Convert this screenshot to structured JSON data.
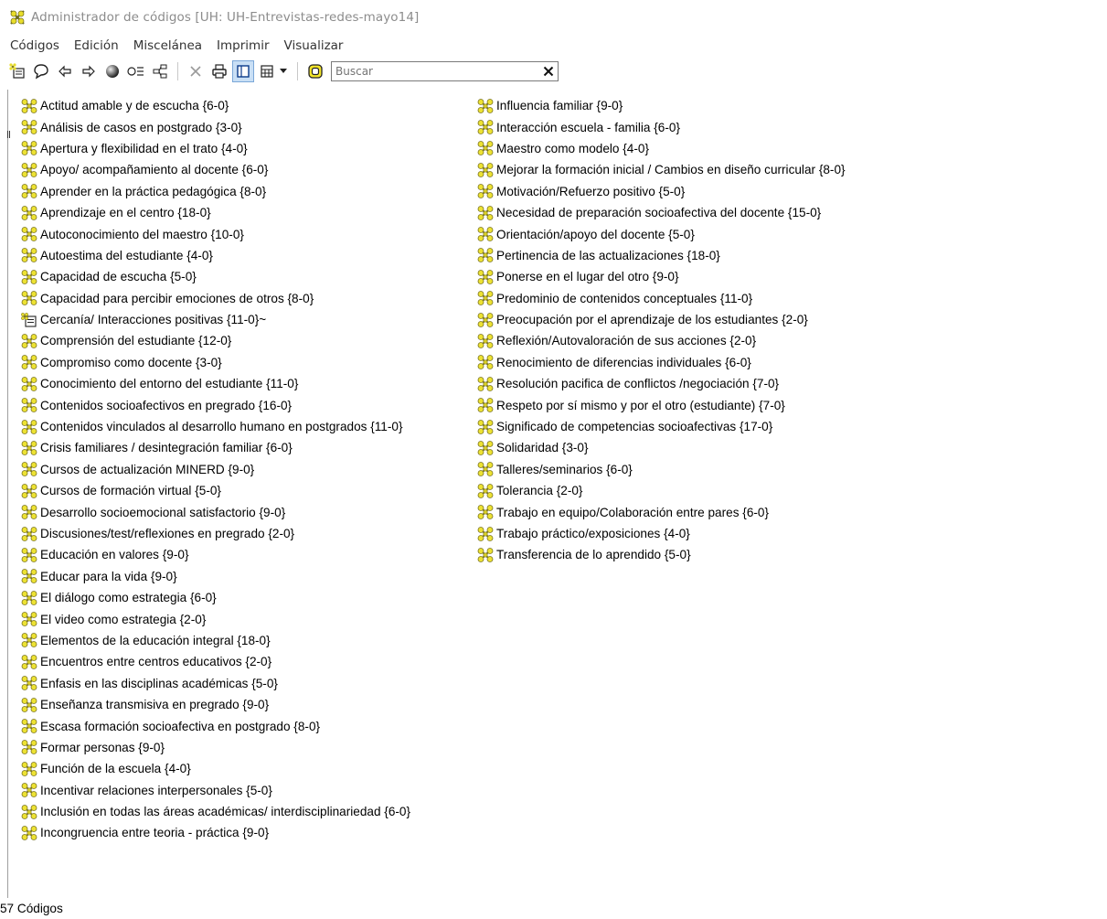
{
  "window": {
    "title": "Administrador de códigos [UH: UH-Entrevistas-redes-mayo14]"
  },
  "menu": [
    "Códigos",
    "Edición",
    "Miscelánea",
    "Imprimir",
    "Visualizar"
  ],
  "toolbar": {
    "icons": [
      "new-code-icon",
      "comment-icon",
      "back-arrow-icon",
      "forward-arrow-icon",
      "color-ball-icon",
      "code-filter-icon",
      "network-icon",
      "delete-icon",
      "print-icon",
      "single-column-view-icon",
      "multi-column-view-icon",
      "dropdown-arrow-icon",
      "search-target-icon"
    ],
    "search_placeholder": "Buscar"
  },
  "codes_column_1": [
    "Actitud amable y de escucha {6-0}",
    "Análisis de casos en postgrado {3-0}",
    "Apertura y flexibilidad en el trato {4-0}",
    "Apoyo/ acompañamiento al docente {6-0}",
    "Aprender en la práctica pedagógica {8-0}",
    "Aprendizaje en el centro {18-0}",
    "Autoconocimiento del maestro {10-0}",
    "Autoestima del estudiante {4-0}",
    "Capacidad de escucha {5-0}",
    "Capacidad para percibir emociones de otros {8-0}",
    "Cercanía/ Interacciones positivas {11-0}~",
    "Comprensión del estudiante {12-0}",
    "Compromiso como docente {3-0}",
    "Conocimiento del entorno del estudiante {11-0}",
    "Contenidos socioafectivos en pregrado {16-0}",
    "Contenidos vinculados al desarrollo humano en postgrados {11-0}",
    "Crisis familiares / desintegración familiar {6-0}",
    "Cursos de actualización MINERD {9-0}",
    "Cursos de formación virtual {5-0}",
    "Desarrollo socioemocional satisfactorio {9-0}",
    "Discusiones/test/reflexiones en pregrado {2-0}",
    "Educación en valores {9-0}",
    "Educar para la vida {9-0}",
    "El diálogo como estrategia {6-0}",
    "El video como estrategia {2-0}",
    "Elementos de  la educación integral {18-0}",
    "Encuentros entre centros educativos {2-0}",
    "Enfasis en las disciplinas académicas {5-0}",
    "Enseñanza transmisiva en pregrado {9-0}",
    "Escasa formación socioafectiva en postgrado {8-0}",
    "Formar personas {9-0}",
    "Función de la escuela {4-0}",
    "Incentivar relaciones interpersonales {5-0}",
    "Inclusión en todas las áreas académicas/ interdisciplinariedad {6-0}",
    "Incongruencia entre teoria - práctica {9-0}"
  ],
  "codes_column_2": [
    "Influencia familiar {9-0}",
    "Interacción escuela - familia {6-0}",
    "Maestro como modelo {4-0}",
    "Mejorar la formación inicial / Cambios en diseño curricular {8-0}",
    "Motivación/Refuerzo positivo {5-0}",
    "Necesidad de preparación socioafectiva del docente {15-0}",
    "Orientación/apoyo del docente {5-0}",
    "Pertinencia de las actualizaciones {18-0}",
    "Ponerse en el lugar del otro {9-0}",
    "Predominio de contenidos conceptuales {11-0}",
    "Preocupación por el aprendizaje de los estudiantes {2-0}",
    "Reflexión/Autovaloración de sus acciones {2-0}",
    "Renocimiento de diferencias individuales {6-0}",
    "Resolución pacifica de conflictos /negociación {7-0}",
    "Respeto por sí mismo y por el otro (estudiante) {7-0}",
    "Significado de competencias socioafectivas {17-0}",
    "Solidaridad {3-0}",
    "Talleres/seminarios {6-0}",
    "Tolerancia {2-0}",
    "Trabajo en equipo/Colaboración entre pares {6-0}",
    "Trabajo práctico/exposiciones {4-0}",
    "Transferencia de lo aprendido {5-0}"
  ],
  "commented_code_index": 10,
  "status": {
    "text": "57 Códigos"
  }
}
